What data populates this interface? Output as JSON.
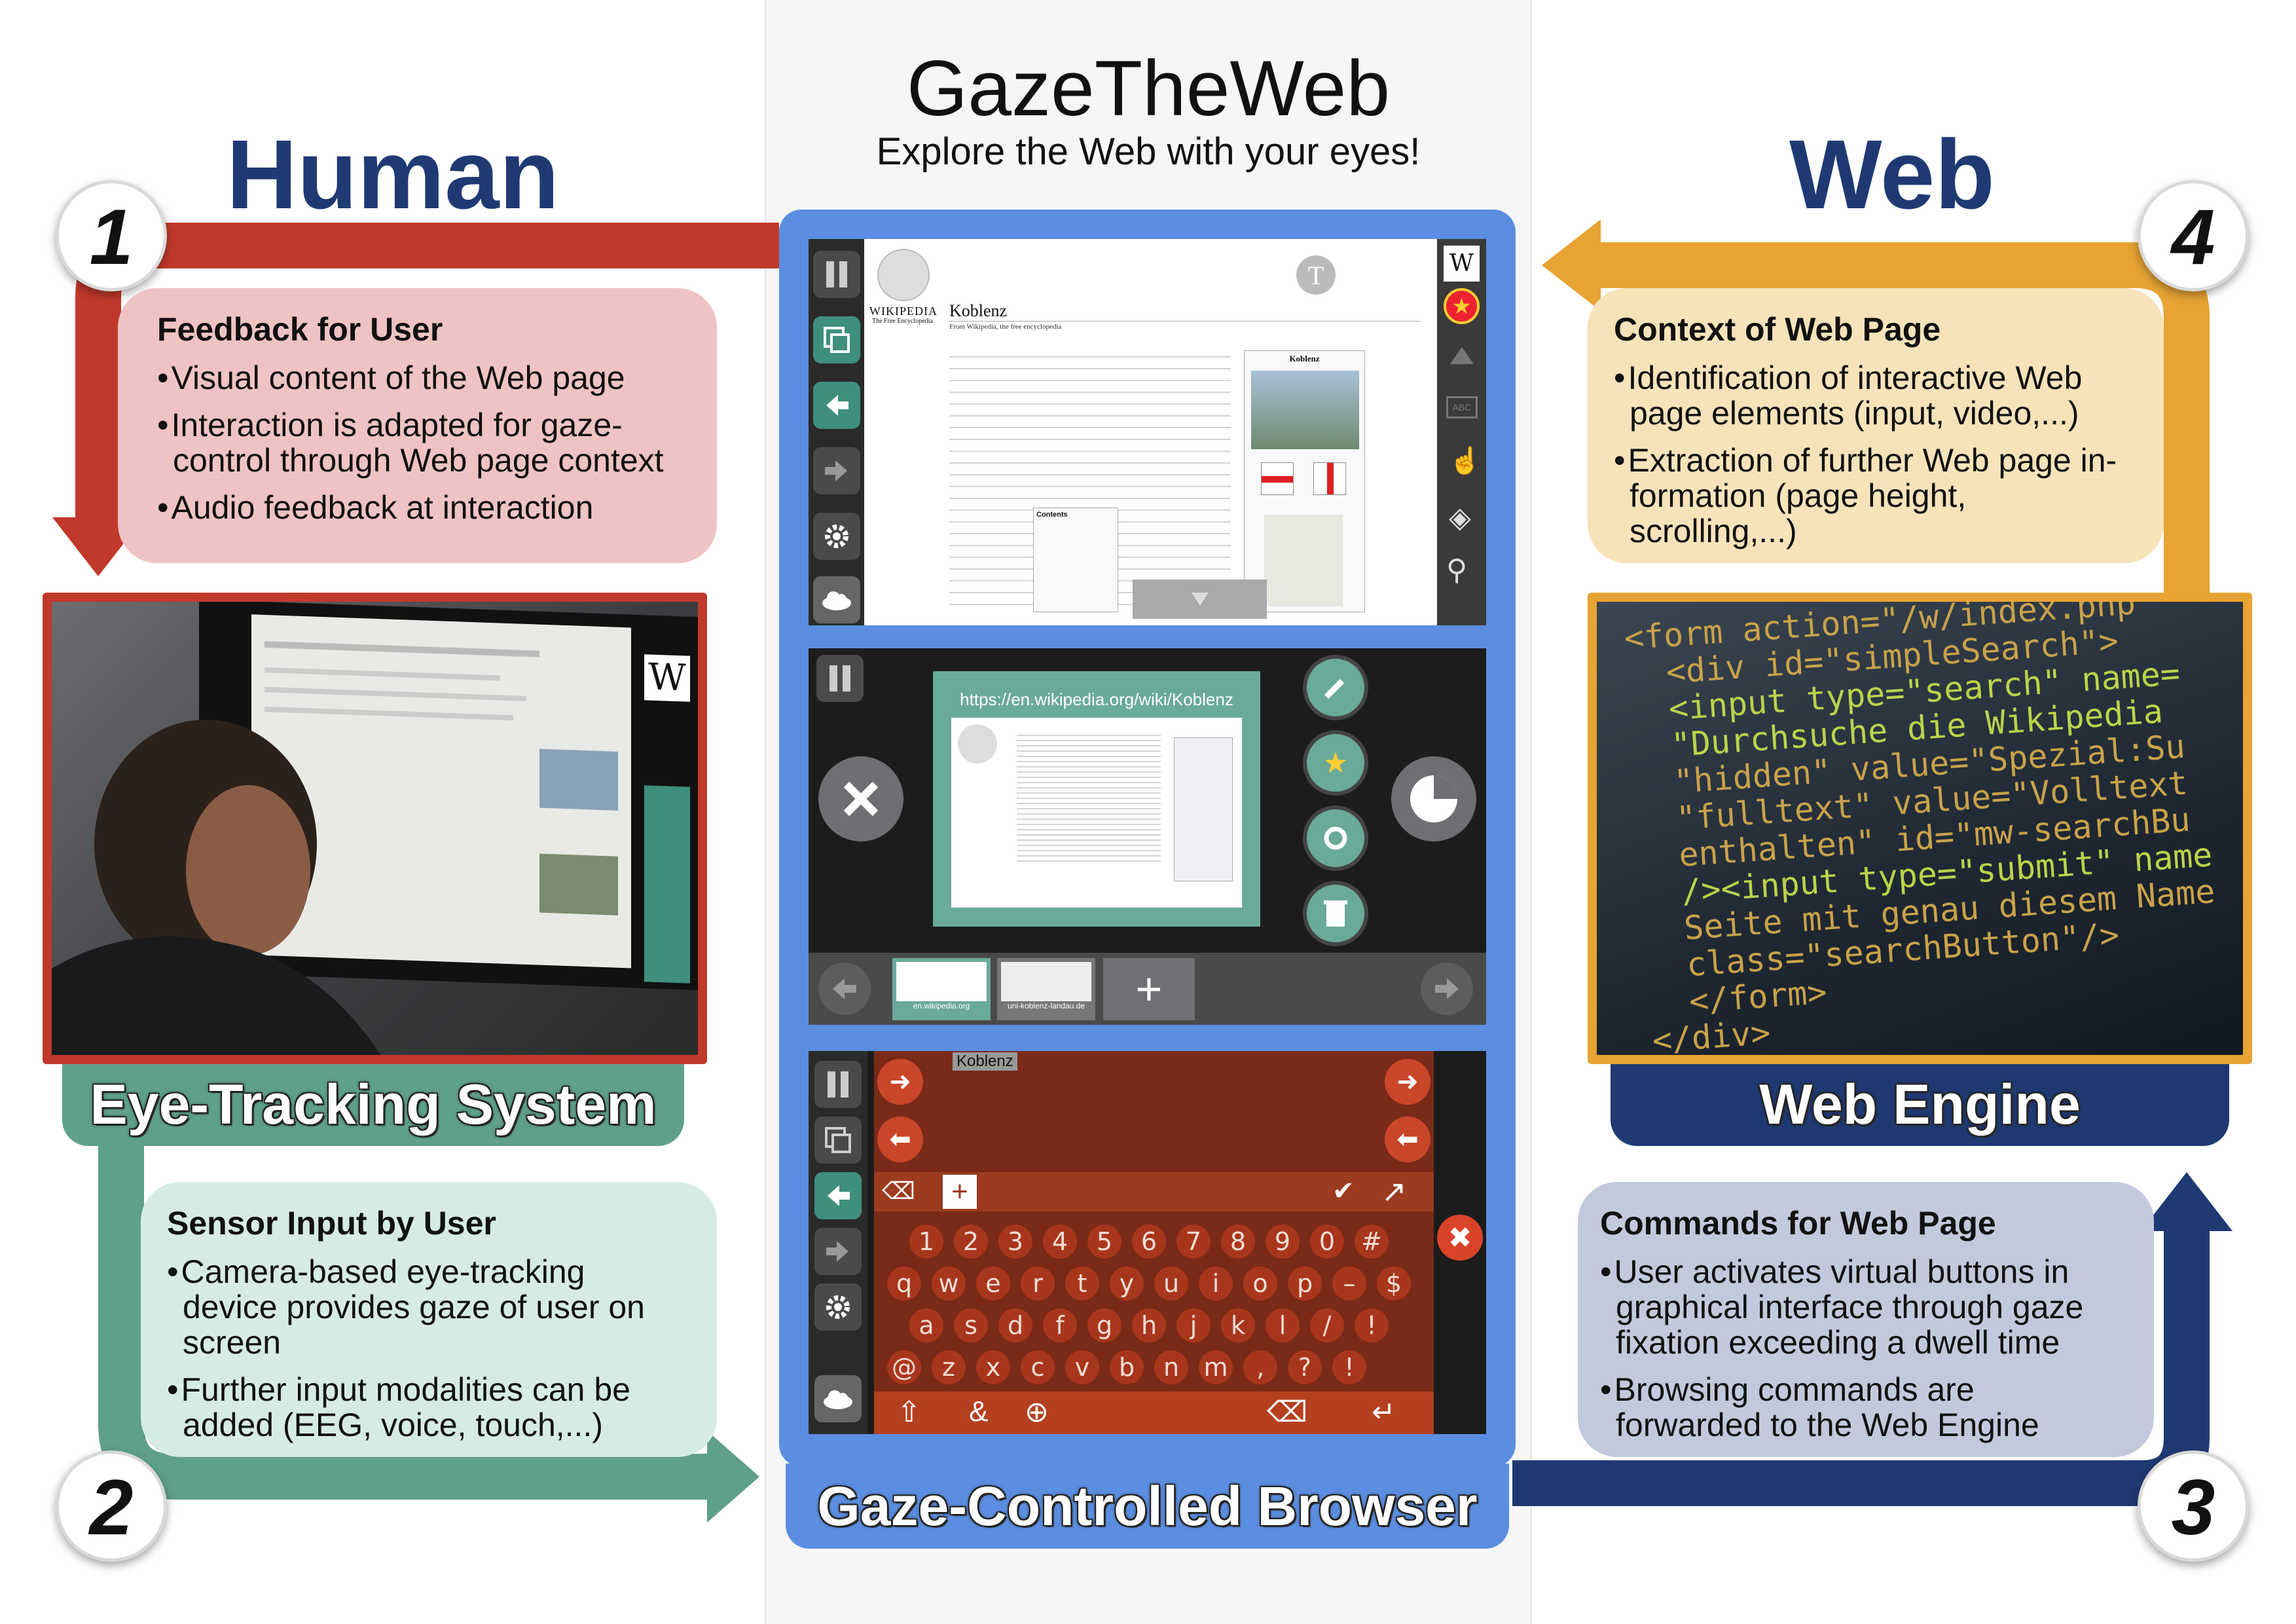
{
  "title": {
    "main": "GazeTheWeb",
    "subtitle": "Explore the Web with your eyes!"
  },
  "headings": {
    "human": "Human",
    "web": "Web"
  },
  "steps": {
    "one": "1",
    "two": "2",
    "three": "3",
    "four": "4"
  },
  "feedback_box": {
    "title": "Feedback for User",
    "items": [
      "Visual content of the Web page",
      "Interaction is adapted for gaze-control through Web page context",
      "Audio feedback at interaction"
    ]
  },
  "context_box": {
    "title": "Context of Web Page",
    "items": [
      "Identification of interactive Web page elements (input, video,...)",
      "Extraction of further Web page in-formation (page height, scrolling,...)"
    ]
  },
  "sensor_box": {
    "title": "Sensor Input by User",
    "items": [
      "Camera-based eye-tracking  device provides gaze of user on screen",
      "Further input modalities can be added (EEG, voice, touch,...)"
    ]
  },
  "commands_box": {
    "title": "Commands for Web Page",
    "items": [
      "User activates virtual buttons in graphical interface through gaze fixation exceeding a dwell time",
      "Browsing commands are forwarded to the Web Engine"
    ]
  },
  "labels": {
    "eye_tracking": "Eye-Tracking System",
    "web_engine": "Web Engine",
    "browser": "Gaze-Controlled Browser"
  },
  "browser_screens": {
    "wiki_article_title": "Koblenz",
    "wiki_logo": "WIKIPEDIA",
    "wiki_tagline": "The Free Encyclopedia",
    "wiki_from": "From Wikipedia, the free encyclopedia",
    "wiki_infobox": "Koblenz",
    "wiki_contents": "Contents",
    "tab_url": "https://en.wikipedia.org/wiki/Koblenz",
    "tab_thumbs": [
      "en.wikipedia.org",
      "uni-koblenz-landau.de"
    ],
    "keyboard_text": "Koblenz",
    "keyboard_rows": [
      [
        "1",
        "2",
        "3",
        "4",
        "5",
        "6",
        "7",
        "8",
        "9",
        "0",
        "#"
      ],
      [
        "q",
        "w",
        "e",
        "r",
        "t",
        "y",
        "u",
        "i",
        "o",
        "p",
        "–",
        "$"
      ],
      [
        "a",
        "s",
        "d",
        "f",
        "g",
        "h",
        "j",
        "k",
        "l",
        "/",
        "!"
      ],
      [
        "@",
        "z",
        "x",
        "c",
        "v",
        "b",
        "n",
        "m",
        "‚",
        "?",
        "!"
      ]
    ]
  },
  "code_lines": [
    "<form action=\"/w/index.php\"",
    "  <div id=\"simpleSearch\">",
    "  <input type=\"search\" name=",
    "  \"Durchsuche die Wikipedia",
    "  \"hidden\" value=\"Spezial:Su",
    "  \"fulltext\" value=\"Volltext",
    "  enthalten\" id=\"mw-searchBu",
    "  /><input type=\"submit\" name",
    "  Seite mit genau diesem Name",
    "  class=\"searchButton\"/>",
    "  </form>",
    "</div>"
  ],
  "colors": {
    "red": "#c0392b",
    "teal": "#5fa08a",
    "orange": "#e7a333",
    "navy": "#1f3a73",
    "blue_frame": "#5b8ee0"
  }
}
